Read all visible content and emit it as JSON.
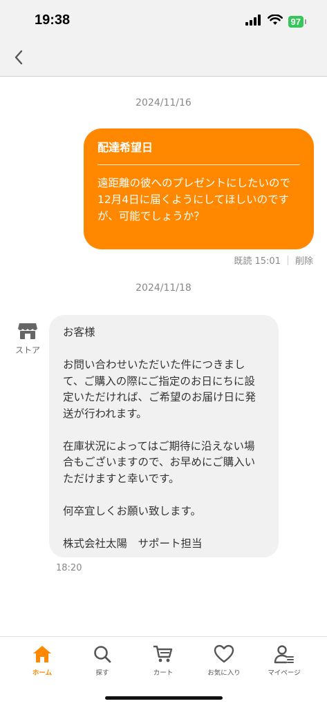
{
  "status_bar": {
    "time": "19:38",
    "battery": "97"
  },
  "chat": {
    "messages": [
      {
        "date": "2024/11/16",
        "title": "配達希望日",
        "body": "遠距離の彼へのプレゼントにしたいので\n12月4日に届くようにしてほしいのですが、可能でしょうか？",
        "status": "既読 15:01",
        "delete_label": "削除"
      },
      {
        "date": "2024/11/18",
        "sender": "ストア",
        "body": "お客様\n\nお問い合わせいただいた件につきまして、ご購入の際にご指定のお日にちに設定いただければ、ご希望のお届け日に発送が行われます。\n\n在庫状況によってはご期待に沿えない場合もございますので、お早めにご購入いただけますと幸いです。\n\n何卒宜しくお願い致します。\n\n株式会社太陽　サポート担当",
        "time": "18:20"
      }
    ]
  },
  "tab_bar": {
    "items": [
      {
        "label": "ホーム",
        "icon": "home-icon",
        "active": true
      },
      {
        "label": "探す",
        "icon": "search-icon"
      },
      {
        "label": "カート",
        "icon": "cart-icon"
      },
      {
        "label": "お気に入り",
        "icon": "heart-icon"
      },
      {
        "label": "マイページ",
        "icon": "user-icon"
      }
    ]
  },
  "colors": {
    "accent": "#ff8800",
    "incoming_bubble": "#f1f1f1"
  }
}
